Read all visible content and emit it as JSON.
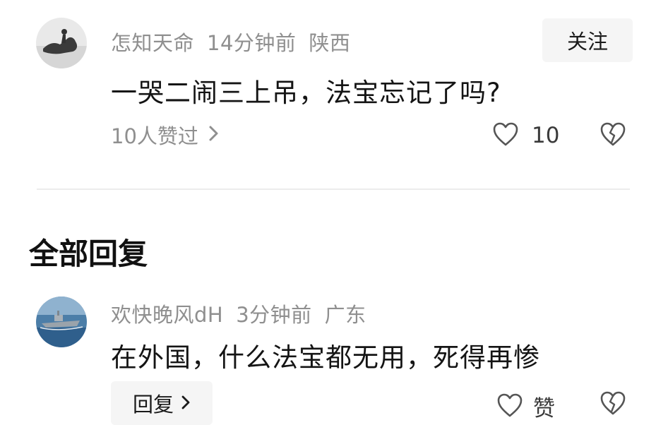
{
  "comment": {
    "username": "怎知天命",
    "time": "14分钟前",
    "location": "陕西",
    "follow_label": "关注",
    "text": "一哭二闹三上吊，法宝忘记了吗?",
    "likers_label": "10人赞过",
    "like_count": "10"
  },
  "replies_section": {
    "title": "全部回复"
  },
  "reply": {
    "username": "欢快晚风dH",
    "time": "3分钟前",
    "location": "广东",
    "text": "在外国，什么法宝都无用，死得再惨",
    "reply_label": "回复",
    "like_label": "赞"
  },
  "icons": {
    "like": "heart-outline-icon",
    "dislike": "broken-heart-icon",
    "chevron": "chevron-right-icon"
  }
}
